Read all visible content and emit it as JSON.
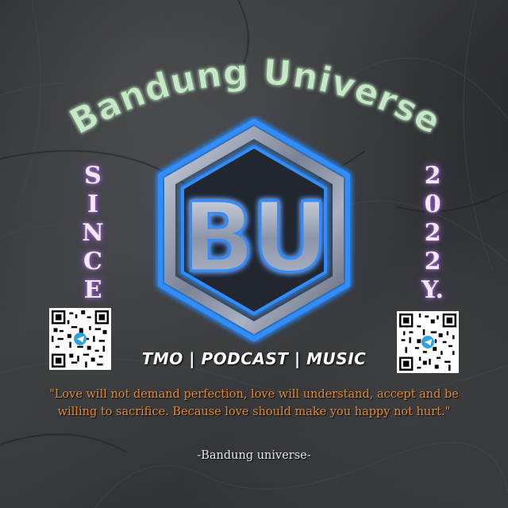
{
  "title": "Bandung Universe",
  "since_letters": [
    "S",
    "I",
    "N",
    "C",
    "E"
  ],
  "year_letters": [
    "2",
    "0",
    "2",
    "2",
    "Y."
  ],
  "logo_letters": "BU",
  "tagline": "TMO | PODCAST | MUSIC",
  "quote": "\"Love will not demand perfection, love will understand, accept and be willing to sacrifice. Because love should make you happy not hurt.\"",
  "signature": "-Bandung universe-",
  "icons": {
    "qr_left": "qr-code-icon",
    "qr_right": "qr-code-icon",
    "telegram": "telegram-icon"
  },
  "colors": {
    "title": "#c7e8c8",
    "neon_blue": "#2f8dff",
    "metal": "#9aa3b5",
    "quote": "#e38a2b",
    "purple_glow": "#8a4fc0"
  }
}
